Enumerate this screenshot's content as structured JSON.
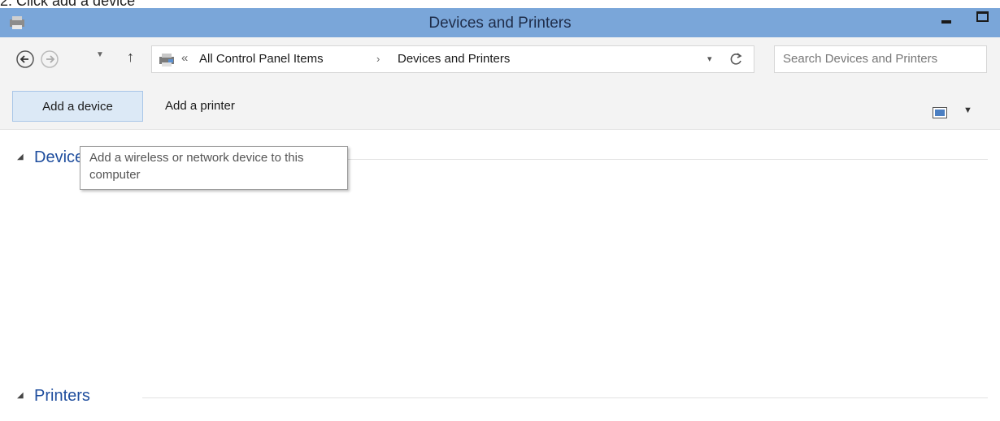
{
  "caption": "2. Click add a device",
  "window": {
    "title": "Devices and Printers",
    "icon": "devices-printers-icon"
  },
  "address": {
    "breadcrumbs": [
      "All Control Panel Items",
      "Devices and Printers"
    ],
    "overflow_glyph": "«",
    "search_placeholder": "Search Devices and Printers"
  },
  "toolbar": {
    "add_device_label": "Add a device",
    "add_printer_label": "Add a printer"
  },
  "tooltip": {
    "text": "Add a wireless or network device to this computer"
  },
  "groups": {
    "devices_title": "Devices",
    "printers_title": "Printers"
  },
  "colors": {
    "titlebar": "#7aa6d9",
    "group_title": "#1f4e9e",
    "selected_button": "#dce9f6"
  }
}
